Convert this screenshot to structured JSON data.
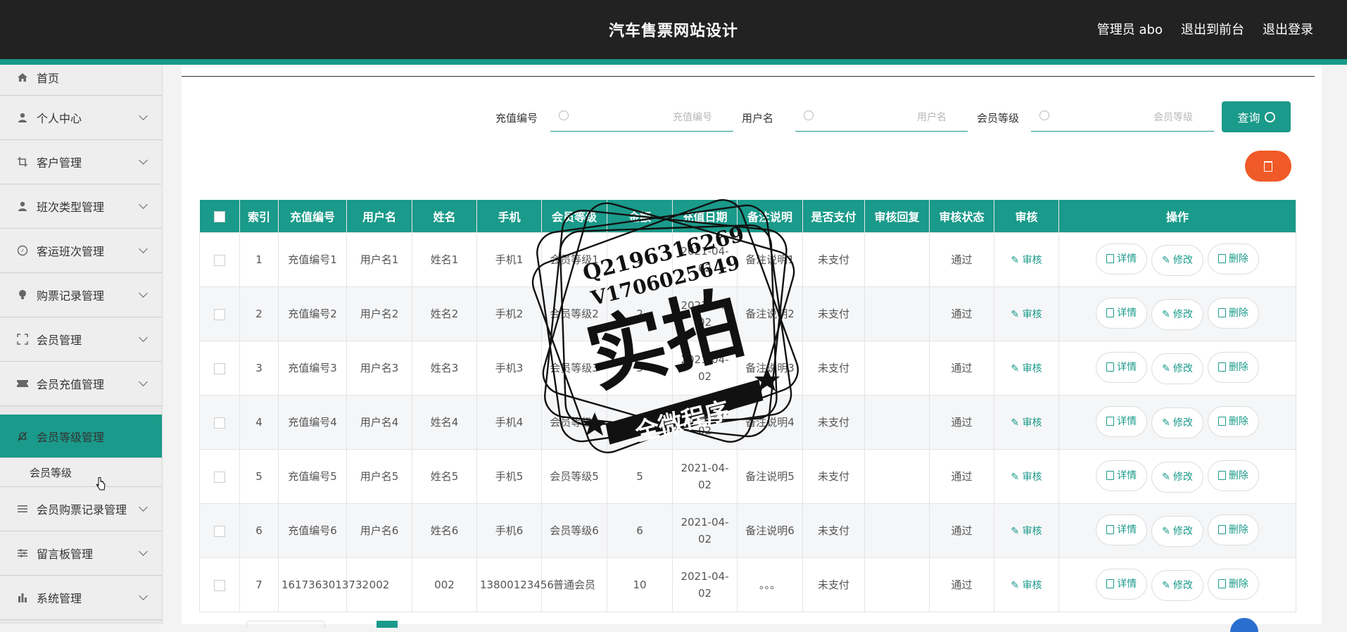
{
  "header": {
    "title": "汽车售票网站设计",
    "user_label": "管理员 abo",
    "back_front": "退出到前台",
    "logout": "退出登录"
  },
  "sidebar": {
    "items": [
      {
        "label": "首页",
        "icon": "home-icon"
      },
      {
        "label": "个人中心",
        "icon": "user-icon"
      },
      {
        "label": "客户管理",
        "icon": "crop-icon"
      },
      {
        "label": "班次类型管理",
        "icon": "user-icon"
      },
      {
        "label": "客运班次管理",
        "icon": "compass-icon"
      },
      {
        "label": "购票记录管理",
        "icon": "bulb-icon"
      },
      {
        "label": "会员管理",
        "icon": "scan-icon"
      },
      {
        "label": "会员充值管理",
        "icon": "ticket-icon"
      },
      {
        "label": "会员等级管理",
        "icon": "bell-off-icon"
      },
      {
        "label": "会员购票记录管理",
        "icon": "list-icon"
      },
      {
        "label": "留言板管理",
        "icon": "sliders-icon"
      },
      {
        "label": "系统管理",
        "icon": "chart-icon"
      }
    ],
    "sub_item": "会员等级",
    "active_color": "#1a9a8a"
  },
  "search": {
    "f1_label": "充值编号",
    "f1_placeholder": "充值编号",
    "f2_label": "用户名",
    "f2_placeholder": "用户名",
    "f3_label": "会员等级",
    "f3_placeholder": "会员等级",
    "query_label": "查询"
  },
  "table": {
    "headers": [
      "索引",
      "充值编号",
      "用户名",
      "姓名",
      "手机",
      "会员等级",
      "金额",
      "充值日期",
      "备注说明",
      "是否支付",
      "审核回复",
      "审核状态",
      "审核",
      "操作"
    ],
    "rows": [
      [
        "1",
        "充值编号1",
        "用户名1",
        "姓名1",
        "手机1",
        "会员等级1",
        "1",
        "2021-04-02",
        "备注说明1",
        "未支付",
        "",
        "通过"
      ],
      [
        "2",
        "充值编号2",
        "用户名2",
        "姓名2",
        "手机2",
        "会员等级2",
        "2",
        "2021-04-02",
        "备注说明2",
        "未支付",
        "",
        "通过"
      ],
      [
        "3",
        "充值编号3",
        "用户名3",
        "姓名3",
        "手机3",
        "会员等级3",
        "3",
        "2021-04-02",
        "备注说明3",
        "未支付",
        "",
        "通过"
      ],
      [
        "4",
        "充值编号4",
        "用户名4",
        "姓名4",
        "手机4",
        "会员等级4",
        "4",
        "2021-04-02",
        "备注说明4",
        "未支付",
        "",
        "通过"
      ],
      [
        "5",
        "充值编号5",
        "用户名5",
        "姓名5",
        "手机5",
        "会员等级5",
        "5",
        "2021-04-02",
        "备注说明5",
        "未支付",
        "",
        "通过"
      ],
      [
        "6",
        "充值编号6",
        "用户名6",
        "姓名6",
        "手机6",
        "会员等级6",
        "6",
        "2021-04-02",
        "备注说明6",
        "未支付",
        "",
        "通过"
      ],
      [
        "7",
        "1617363013732",
        "002",
        "002",
        "13800123456",
        "普通会员",
        "10",
        "2021-04-02",
        "。。。",
        "未支付",
        "",
        "通过"
      ]
    ],
    "audit_label": "审核",
    "detail_label": "详情",
    "edit_label": "修改",
    "delete_label": "删除"
  },
  "watermark": {
    "qq": "Q2196316269",
    "vx": "V1706025649",
    "big": "实拍",
    "banner": "全微程序"
  },
  "colors": {
    "primary": "#1a9a8a",
    "danger": "#f05a28",
    "topbar": "#222222"
  }
}
